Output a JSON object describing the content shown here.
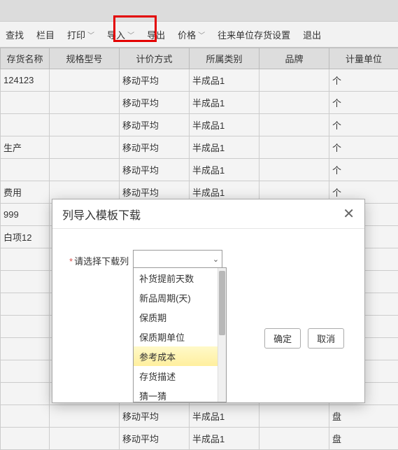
{
  "toolbar": {
    "find": "查找",
    "column": "栏目",
    "print": "打印",
    "import": "导入",
    "export": "导出",
    "price": "价格",
    "supplier_setting": "往来单位存货设置",
    "exit": "退出"
  },
  "table": {
    "headers": [
      "存货名称",
      "规格型号",
      "计价方式",
      "所属类别",
      "品牌",
      "计量单位"
    ],
    "rows": [
      [
        "124123",
        "",
        "移动平均",
        "半成品1",
        "",
        "个"
      ],
      [
        "",
        "",
        "移动平均",
        "半成品1",
        "",
        "个"
      ],
      [
        "",
        "",
        "移动平均",
        "半成品1",
        "",
        "个"
      ],
      [
        "生产",
        "",
        "移动平均",
        "半成品1",
        "",
        "个"
      ],
      [
        "",
        "",
        "移动平均",
        "半成品1",
        "",
        "个"
      ],
      [
        "费用",
        "",
        "移动平均",
        "半成品1",
        "",
        "个"
      ],
      [
        "999",
        "",
        "",
        "",
        "",
        ""
      ],
      [
        "白项12",
        "",
        "",
        "",
        "",
        ""
      ],
      [
        "",
        "",
        "",
        "",
        "",
        ""
      ],
      [
        "",
        "",
        "",
        "",
        "",
        ""
      ],
      [
        "",
        "",
        "",
        "",
        "",
        ""
      ],
      [
        "",
        "",
        "",
        "",
        "",
        ""
      ],
      [
        "",
        "",
        "",
        "",
        "",
        ""
      ],
      [
        "",
        "",
        "",
        "",
        "",
        ""
      ],
      [
        "",
        "",
        "",
        "",
        "",
        ""
      ],
      [
        "",
        "",
        "移动平均",
        "半成品1",
        "",
        "盘"
      ],
      [
        "",
        "",
        "移动平均",
        "半成品1",
        "",
        "盘"
      ]
    ]
  },
  "modal": {
    "title": "列导入模板下载",
    "field_label": "请选择下载列",
    "ok": "确定",
    "cancel": "取消",
    "options": [
      "补货提前天数",
      "新品周期(天)",
      "保质期",
      "保质期单位",
      "参考成本",
      "存货描述",
      "猜一猜"
    ],
    "hover_index": 4
  }
}
